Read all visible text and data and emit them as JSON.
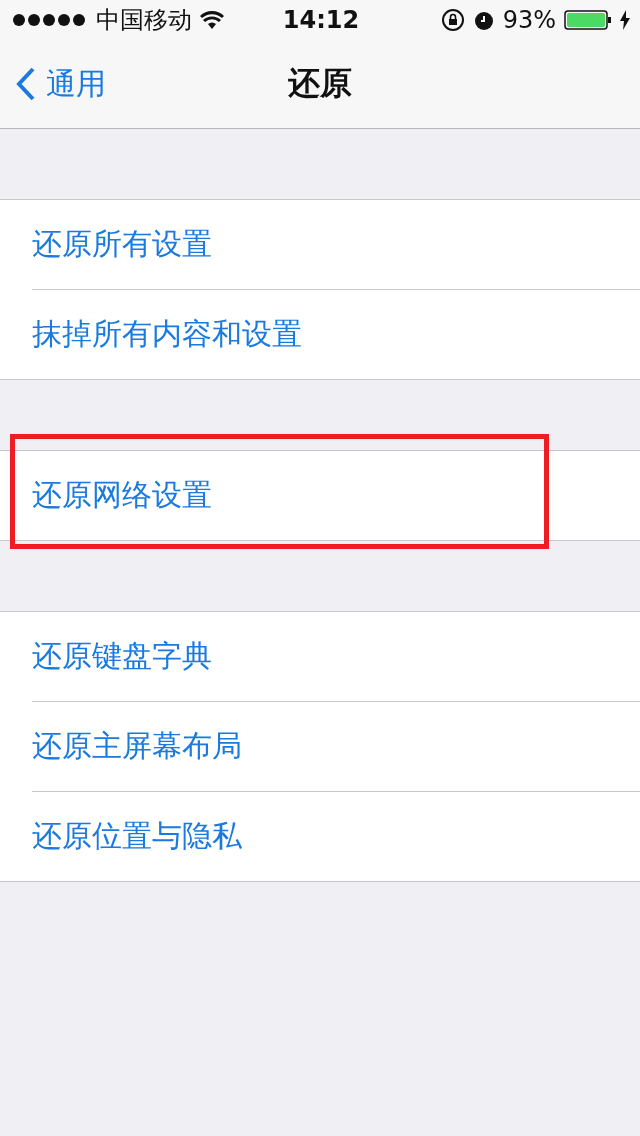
{
  "status_bar": {
    "carrier": "中国移动",
    "time": "14:12",
    "battery": "93%"
  },
  "nav": {
    "back": "通用",
    "title": "还原"
  },
  "groups": [
    {
      "items": [
        {
          "label": "还原所有设置",
          "highlighted": false
        },
        {
          "label": "抹掉所有内容和设置",
          "highlighted": false
        }
      ]
    },
    {
      "items": [
        {
          "label": "还原网络设置",
          "highlighted": true
        }
      ]
    },
    {
      "items": [
        {
          "label": "还原键盘字典",
          "highlighted": false
        },
        {
          "label": "还原主屏幕布局",
          "highlighted": false
        },
        {
          "label": "还原位置与隐私",
          "highlighted": false
        }
      ]
    }
  ]
}
